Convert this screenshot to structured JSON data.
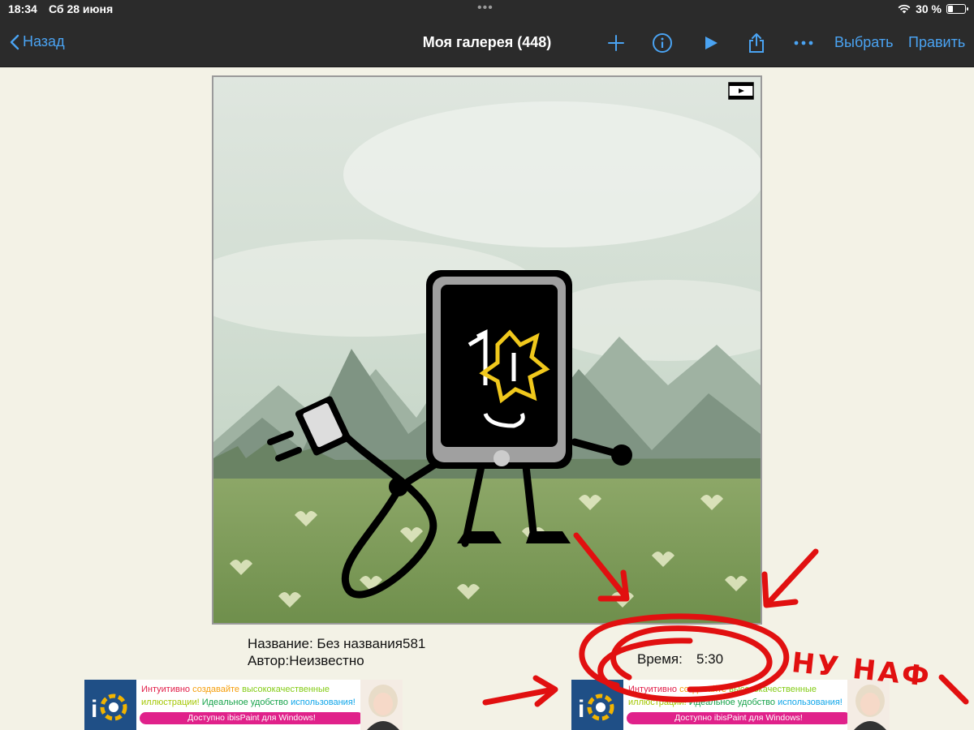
{
  "status_bar": {
    "time": "18:34",
    "date": "Сб 28 июня",
    "battery": "30 %",
    "battery_level": 0.3
  },
  "nav": {
    "back_label": "Назад",
    "title": "Моя галерея (448)",
    "select_label": "Выбрать",
    "edit_label": "Править",
    "icons": [
      "plus-icon",
      "info-icon",
      "play-icon",
      "share-icon",
      "more-icon"
    ]
  },
  "artwork": {
    "name_line": "Название: Без названия581",
    "author_line": "Автор:Неизвестно",
    "time_label": "Время:",
    "time_value": "5:30",
    "badge": "video-icon"
  },
  "ads": [
    {
      "line1_a": "Интуитивно",
      "line1_b": "создавайте",
      "line1_c": "высококачественные",
      "line2_a": "иллюстрации!",
      "line2_b": "Идеальное удобство",
      "line2_c": "использования!",
      "cta": "Доступно ibisPaint для Windows!"
    },
    {
      "line1_a": "Интуитивно",
      "line1_b": "создавайте",
      "line1_c": "высококачественные",
      "line2_a": "иллюстрации!",
      "line2_b": "Идеальное удобство",
      "line2_c": "использования!",
      "cta": "Доступно ibisPaint для Windows!"
    }
  ],
  "annotation": {
    "scribble_text": "НУ НАФ",
    "color": "#e11010"
  },
  "colors": {
    "accent": "#4aa3f2",
    "bar": "#2b2b2b",
    "page_bg": "#f3f2e6"
  }
}
